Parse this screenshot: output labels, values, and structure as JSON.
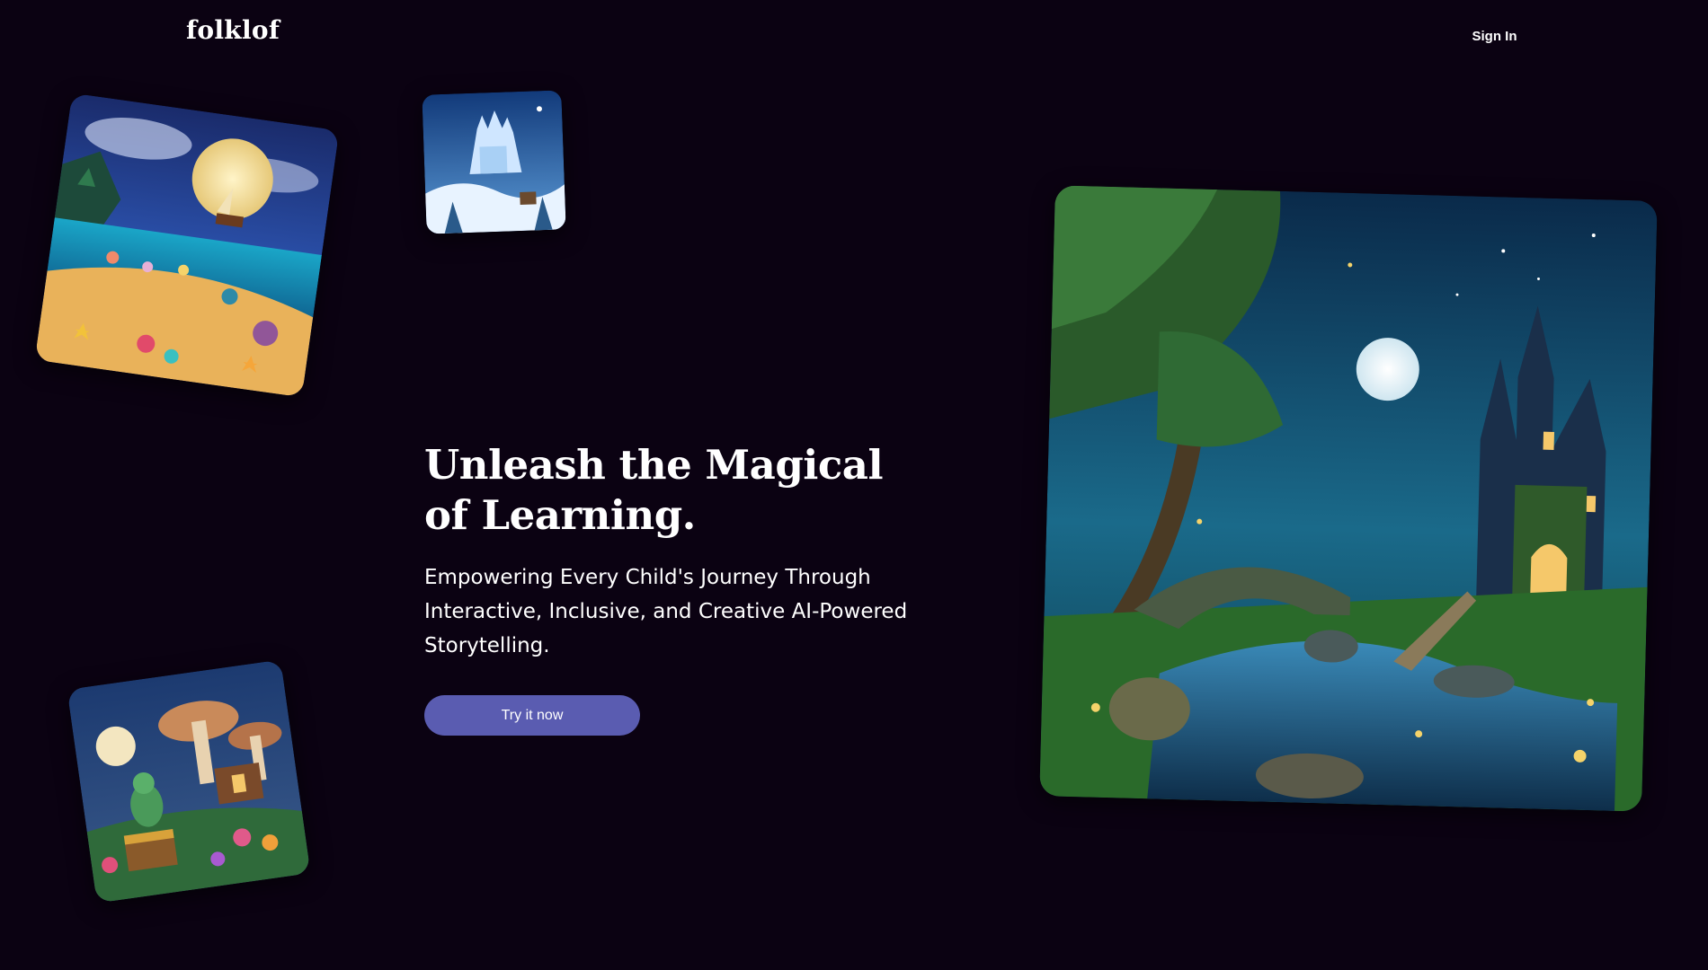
{
  "header": {
    "logo": "folklof",
    "sign_in_label": "Sign In"
  },
  "hero": {
    "title": "Unleash the Magical of Learning.",
    "subtitle": "Empowering Every Child's Journey Through Interactive, Inclusive, and Creative AI-Powered Storytelling.",
    "cta_label": "Try it now"
  },
  "colors": {
    "background": "#0b0212",
    "accent": "#5a5cb1",
    "text": "#ffffff"
  }
}
